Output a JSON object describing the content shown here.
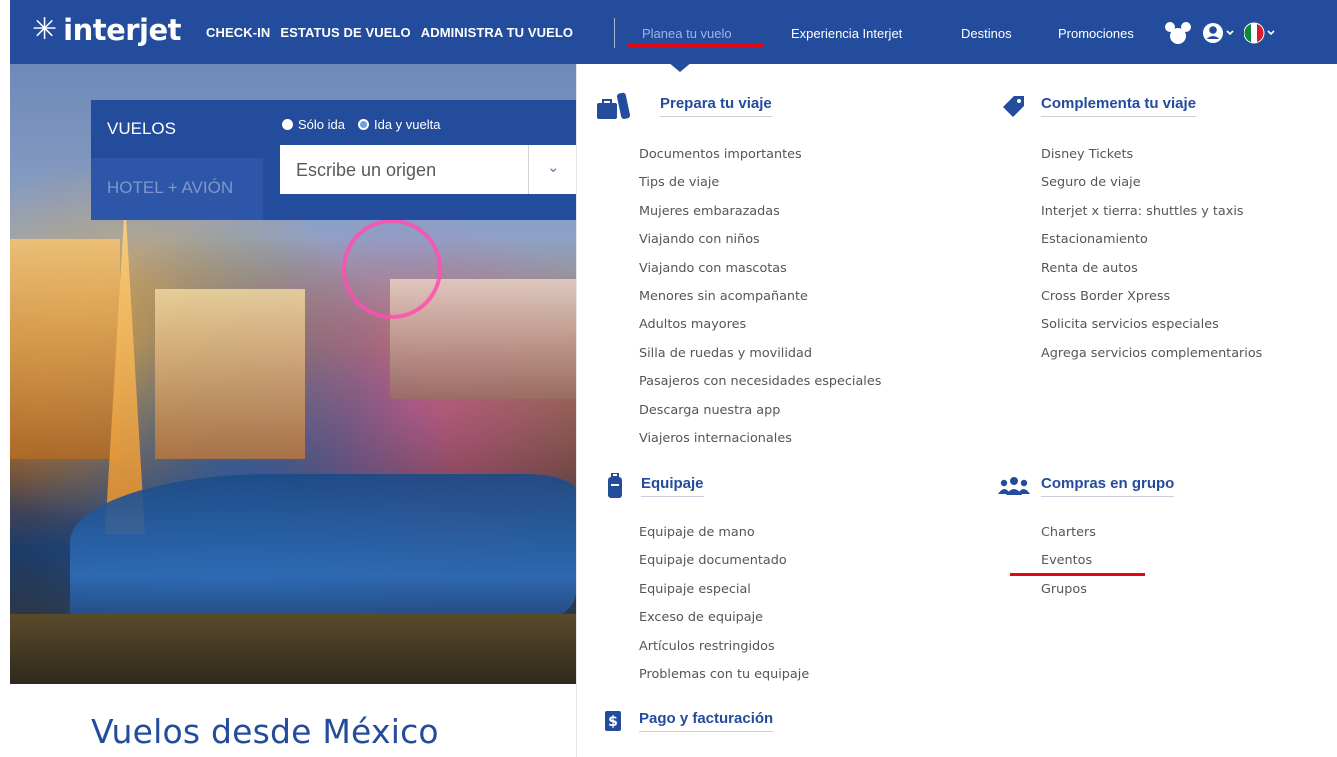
{
  "brand": {
    "logo_text": "interjet",
    "logo_icon": "asterisk-star-icon"
  },
  "nav": {
    "left_links": [
      "CHECK-IN",
      "ESTATUS DE VUELO",
      "ADMINISTRA TU VUELO"
    ],
    "right_links": [
      {
        "label": "Planea tu vuelo",
        "active": true
      },
      {
        "label": "Experiencia Interjet",
        "active": false
      },
      {
        "label": "Destinos",
        "active": false
      },
      {
        "label": "Promociones",
        "active": false
      }
    ],
    "icons": [
      "mickey-ears-icon",
      "user-account-icon",
      "mexico-flag-icon"
    ]
  },
  "search": {
    "tabs": [
      "VUELOS",
      "HOTEL + AVIÓN"
    ],
    "trip_options": [
      {
        "label": "Sólo ida",
        "selected": false
      },
      {
        "label": "Ida y vuelta",
        "selected": true
      }
    ],
    "origin_placeholder": "Escribe un origen"
  },
  "hero": {
    "title": "Vuelos desde México"
  },
  "menu": {
    "prepara": {
      "title": "Prepara tu viaje",
      "icon": "luggage-icon",
      "items": [
        "Documentos importantes",
        "Tips de viaje",
        "Mujeres embarazadas",
        "Viajando con niños",
        "Viajando con mascotas",
        "Menores sin acompañante",
        "Adultos mayores",
        "Silla de ruedas y movilidad",
        "Pasajeros con necesidades especiales",
        "Descarga nuestra app",
        "Viajeros internacionales"
      ]
    },
    "complementa": {
      "title": "Complementa tu viaje",
      "icon": "tag-icon",
      "items": [
        "Disney Tickets",
        "Seguro de viaje",
        "Interjet x tierra: shuttles y taxis",
        "Estacionamiento",
        "Renta de autos",
        "Cross Border Xpress",
        "Solicita servicios especiales",
        "Agrega servicios complementarios"
      ]
    },
    "equipaje": {
      "title": "Equipaje",
      "icon": "suitcase-icon",
      "items": [
        "Equipaje de mano",
        "Equipaje documentado",
        "Equipaje especial",
        "Exceso de equipaje",
        "Artículos restringidos",
        "Problemas con tu equipaje"
      ]
    },
    "grupo": {
      "title": "Compras en grupo",
      "icon": "group-people-icon",
      "items": [
        "Charters",
        "Eventos",
        "Grupos"
      ]
    },
    "pago": {
      "title": "Pago y facturación",
      "icon": "dollar-icon"
    }
  },
  "colors": {
    "brand_blue": "#244c9c",
    "accent_red": "#e30613",
    "menu_text": "#555555"
  }
}
